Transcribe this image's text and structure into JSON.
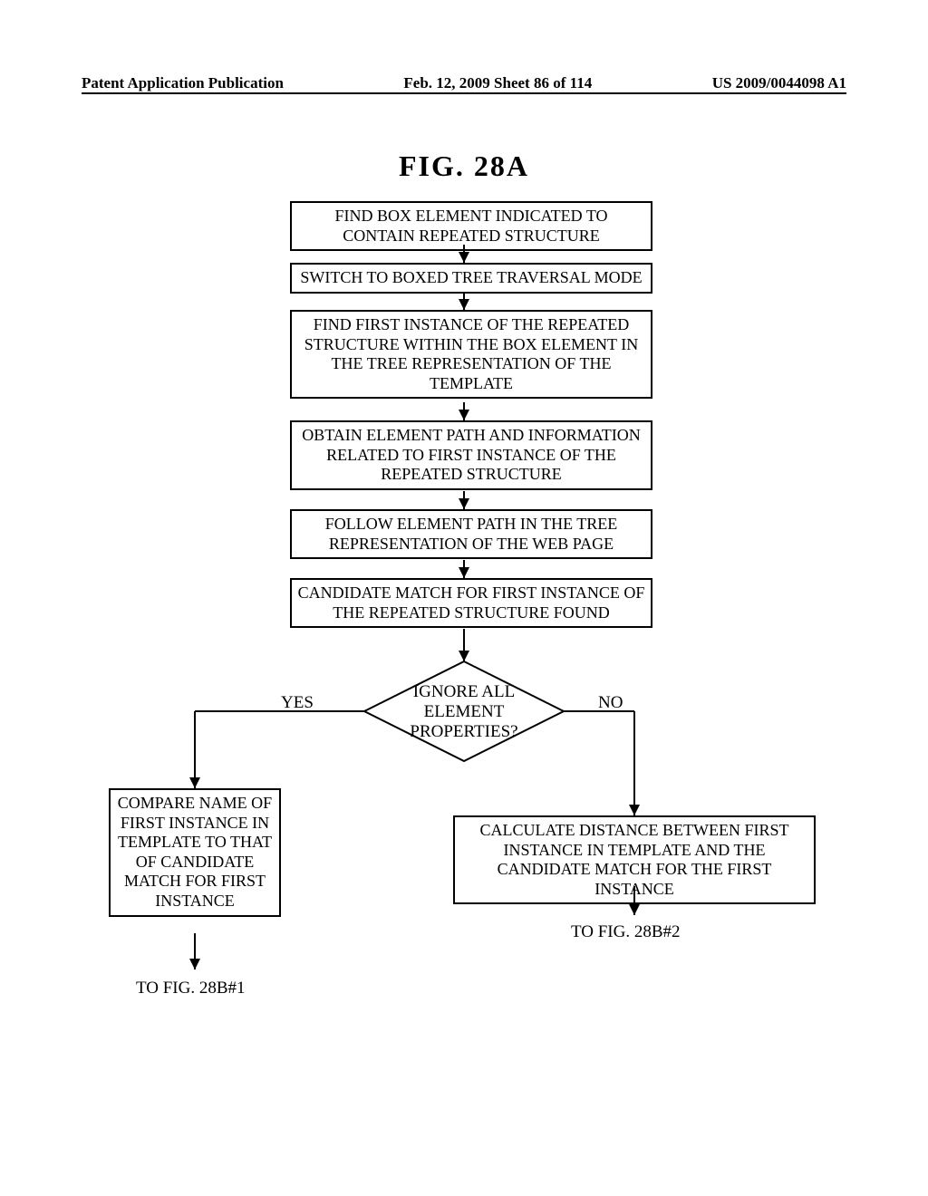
{
  "header": {
    "left": "Patent Application Publication",
    "mid": "Feb. 12, 2009  Sheet 86 of 114",
    "right": "US 2009/0044098 A1"
  },
  "figure_title": "FIG. 28A",
  "boxes": {
    "b1": "FIND BOX ELEMENT INDICATED TO CONTAIN REPEATED STRUCTURE",
    "b2": "SWITCH TO BOXED TREE TRAVERSAL MODE",
    "b3": "FIND FIRST INSTANCE OF THE REPEATED STRUCTURE WITHIN THE BOX ELEMENT IN THE TREE REPRESENTATION OF THE TEMPLATE",
    "b4": "OBTAIN ELEMENT PATH AND INFORMATION RELATED TO FIRST INSTANCE OF THE REPEATED STRUCTURE",
    "b5": "FOLLOW ELEMENT PATH IN THE TREE REPRESENTATION OF THE WEB PAGE",
    "b6": "CANDIDATE MATCH FOR FIRST INSTANCE OF THE REPEATED STRUCTURE FOUND",
    "decision": "IGNORE ALL ELEMENT PROPERTIES?",
    "left_branch": "COMPARE NAME OF FIRST INSTANCE IN TEMPLATE TO THAT OF CANDIDATE MATCH FOR FIRST INSTANCE",
    "right_branch": "CALCULATE DISTANCE BETWEEN FIRST INSTANCE IN TEMPLATE AND THE CANDIDATE MATCH FOR THE FIRST INSTANCE"
  },
  "labels": {
    "yes": "YES",
    "no": "NO",
    "to_left": "TO FIG. 28B#1",
    "to_right": "TO FIG. 28B#2"
  }
}
